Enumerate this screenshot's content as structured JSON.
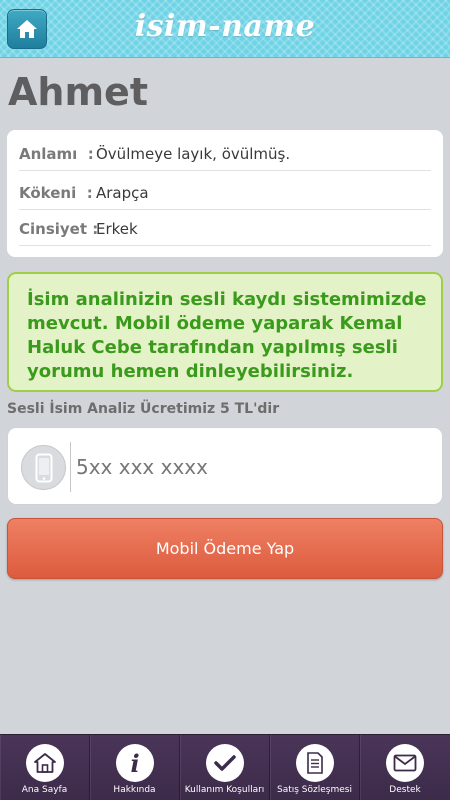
{
  "header": {
    "title": "isim-name",
    "home_icon": "home-icon"
  },
  "name": "Ahmet",
  "details": [
    {
      "label": "Anlamı",
      "separator": ":",
      "value": "Övülmeye layık, övülmüş."
    },
    {
      "label": "Kökeni",
      "separator": ":",
      "value": "Arapça"
    },
    {
      "label": "Cinsiyet",
      "separator": ":",
      "value": "Erkek"
    }
  ],
  "notice": "İsim analinizin sesli kaydı sistemimizde mevcut. Mobil ödeme yaparak Kemal Haluk Cebe tarafından yapılmış sesli yorumu hemen dinleyebilirsiniz.",
  "price_label": "Sesli İsim Analiz Ücretimiz 5 TL'dir",
  "phone": {
    "placeholder": "5xx xxx xxxx",
    "value": "",
    "icon": "phone-icon"
  },
  "pay_button": "Mobil Ödeme Yap",
  "tabs": [
    {
      "label": "Ana Sayfa",
      "icon": "house-icon"
    },
    {
      "label": "Hakkında",
      "icon": "info-icon"
    },
    {
      "label": "Kullanım Koşulları",
      "icon": "checkmark-icon"
    },
    {
      "label": "Satış Sözleşmesi",
      "icon": "document-icon"
    },
    {
      "label": "Destek",
      "icon": "envelope-icon"
    }
  ],
  "colors": {
    "header": "#6fd3e6",
    "notice_bg": "#e4f2c7",
    "notice_text": "#3a9a1c",
    "pay_button": "#e46a4d",
    "tabbar": "#433050"
  }
}
